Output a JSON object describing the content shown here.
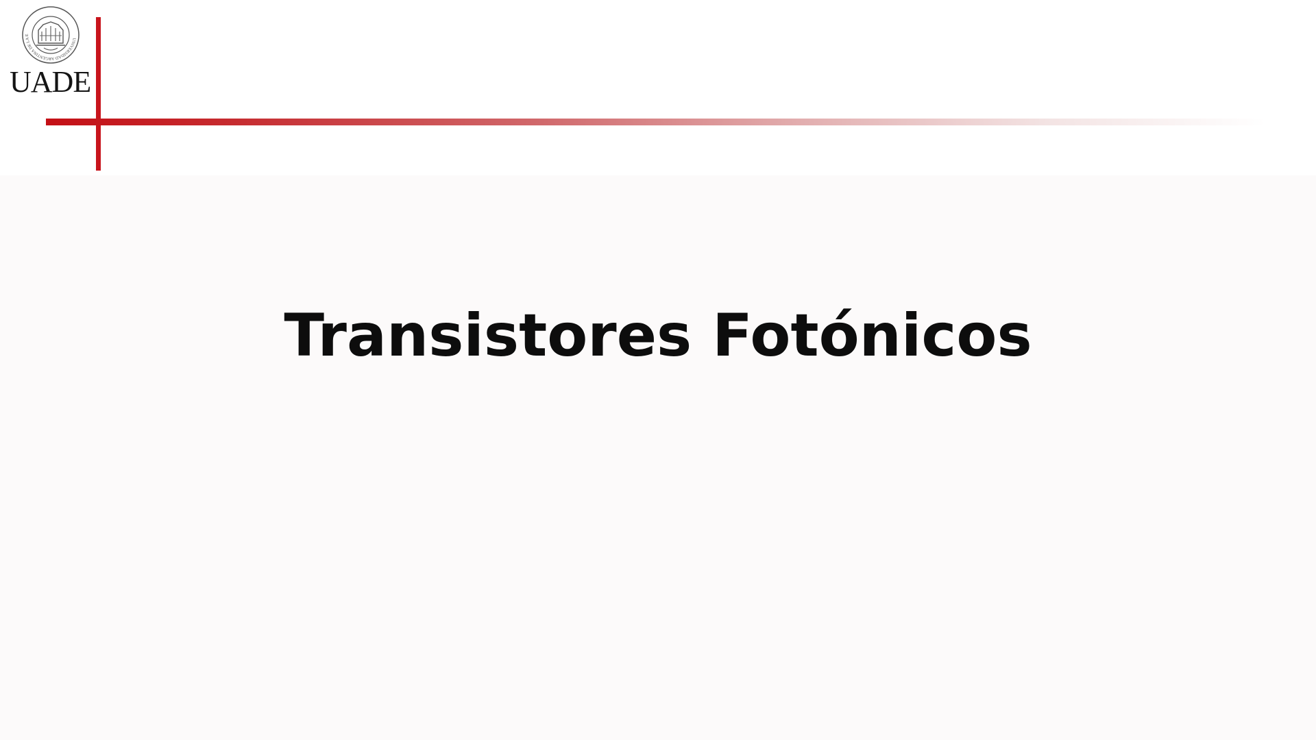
{
  "header": {
    "logo": {
      "icon": "university-seal-icon",
      "wordmark": "UADE",
      "seal_text": "UNIVERSIDAD ARGENTINA DE LA EMPRESA"
    },
    "accent_color": "#c8141c"
  },
  "main": {
    "title": "Transistores Fotónicos"
  }
}
